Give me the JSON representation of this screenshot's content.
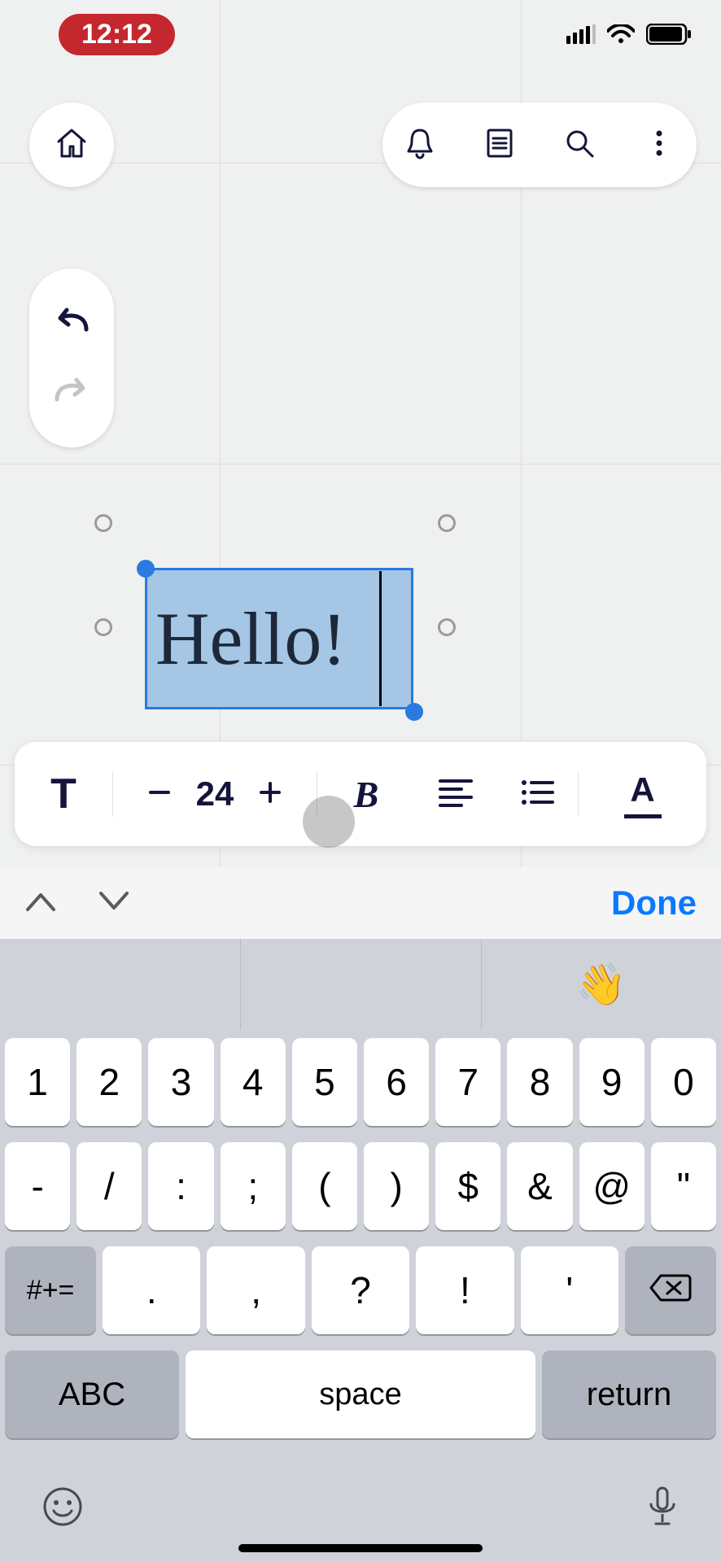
{
  "status_bar": {
    "time": "12:12"
  },
  "canvas": {
    "text_value": "Hello!",
    "text_selected": "Hello"
  },
  "format_bar": {
    "text_tool_label": "T",
    "font_size": "24",
    "bold_label": "B",
    "font_label": "A"
  },
  "kb_accessory": {
    "done_label": "Done"
  },
  "suggestions": {
    "left": "",
    "center": "",
    "right": "👋"
  },
  "keyboard": {
    "row1": [
      "1",
      "2",
      "3",
      "4",
      "5",
      "6",
      "7",
      "8",
      "9",
      "0"
    ],
    "row2": [
      "-",
      "/",
      ":",
      ";",
      "(",
      ")",
      "$",
      "&",
      "@",
      "\""
    ],
    "row3_left": "#+=",
    "row3_mid": [
      ".",
      ",",
      "?",
      "!",
      "'"
    ],
    "row4": {
      "abc": "ABC",
      "space": "space",
      "return": "return"
    }
  }
}
